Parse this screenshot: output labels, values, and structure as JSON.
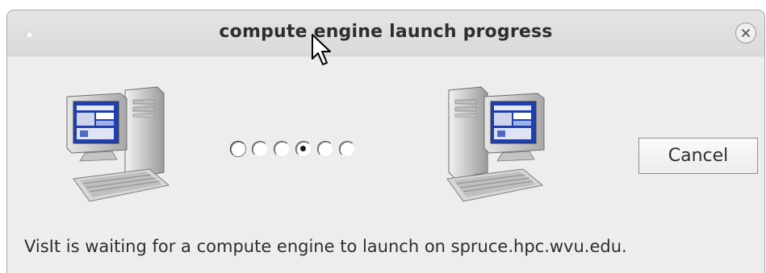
{
  "window": {
    "title": "compute engine launch progress"
  },
  "progress": {
    "radio_count": 6,
    "checked_index": 3,
    "focused_index": 0
  },
  "buttons": {
    "cancel_label": "Cancel"
  },
  "status": {
    "message": "VisIt is waiting for a compute engine to launch on spruce.hpc.wvu.edu."
  },
  "icons": {
    "left_computer": "desktop-computer-icon",
    "right_computer": "desktop-computer-icon",
    "close": "close-icon",
    "cursor": "mouse-pointer-icon"
  },
  "colors": {
    "dialog_bg": "#ededed",
    "titlebar_bg": "#dadada",
    "text": "#2e2e2e",
    "monitor_screen": "#1f3fb0"
  }
}
